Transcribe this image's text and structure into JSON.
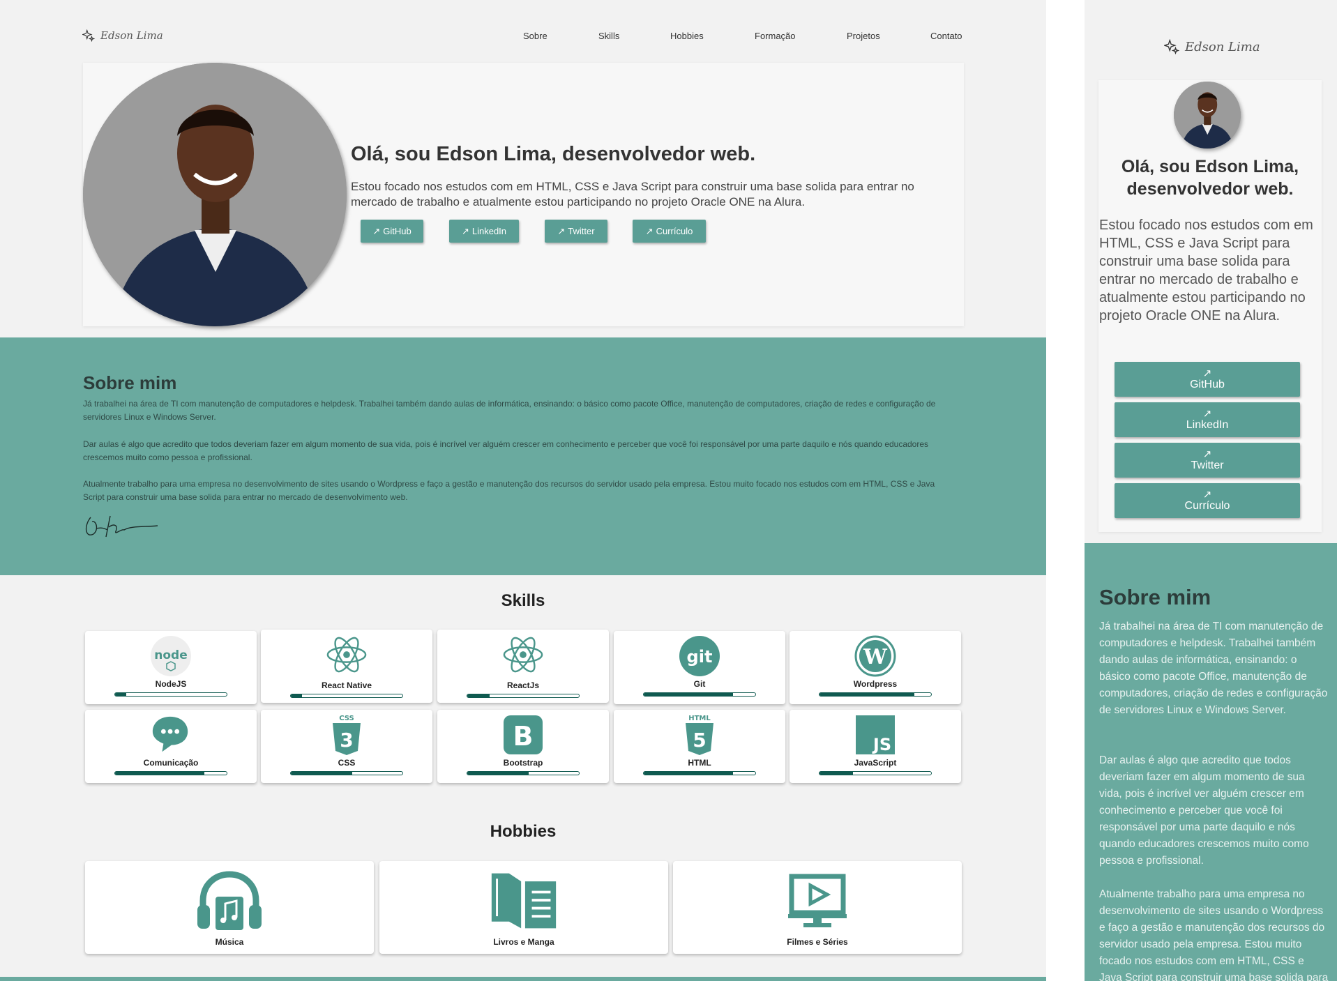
{
  "brand": {
    "name": "Edson Lima"
  },
  "nav": [
    "Sobre",
    "Skills",
    "Hobbies",
    "Formação",
    "Projetos",
    "Contato"
  ],
  "hero": {
    "title": "Olá, sou Edson Lima, desenvolvedor web.",
    "mobile_title": "Olá, sou Edson Lima, desenvolvedor web.",
    "text": "Estou focado nos estudos com em HTML, CSS e Java Script para construir uma base solida para entrar no mercado de trabalho e atualmente estou participando no projeto Oracle ONE na Alura.",
    "buttons": [
      {
        "label": "GitHub"
      },
      {
        "label": "LinkedIn"
      },
      {
        "label": "Twitter"
      },
      {
        "label": "Currículo"
      }
    ]
  },
  "about": {
    "title": "Sobre mim",
    "paragraphs": [
      "Já trabalhei na área de TI com manutenção de computadores e helpdesk. Trabalhei também dando aulas de informática, ensinando: o básico como pacote Office, manutenção de computadores, criação de redes e configuração de servidores Linux e Windows Server.",
      "Dar aulas é algo que acredito que todos deveriam fazer em algum momento de sua vida, pois é incrível ver alguém crescer em conhecimento e perceber que você foi responsável por uma parte daquilo e nós quando educadores crescemos muito como pessoa e profissional.",
      "Atualmente trabalho para uma empresa no desenvolvimento de sites usando o Wordpress e faço a gestão e manutenção dos recursos do servidor usado pela empresa. Estou muito focado nos estudos com em HTML, CSS e Java Script para construir uma base solida para entrar no mercado de desenvolvimento web."
    ]
  },
  "skills": {
    "title": "Skills",
    "items": [
      {
        "label": "NodeJS",
        "icon": "nodejs-icon",
        "level": 0.1
      },
      {
        "label": "React Native",
        "icon": "react-icon",
        "level": 0.1
      },
      {
        "label": "ReactJs",
        "icon": "react-icon",
        "level": 0.2
      },
      {
        "label": "Git",
        "icon": "git-icon",
        "level": 0.8
      },
      {
        "label": "Wordpress",
        "icon": "wordpress-icon",
        "level": 0.85
      },
      {
        "label": "Comunicação",
        "icon": "chat-icon",
        "level": 0.8
      },
      {
        "label": "CSS",
        "icon": "css3-icon",
        "level": 0.55
      },
      {
        "label": "Bootstrap",
        "icon": "bootstrap-icon",
        "level": 0.55
      },
      {
        "label": "HTML",
        "icon": "html5-icon",
        "level": 0.8
      },
      {
        "label": "JavaScript",
        "icon": "javascript-icon",
        "level": 0.3
      }
    ]
  },
  "hobbies": {
    "title": "Hobbies",
    "items": [
      {
        "label": "Música",
        "icon": "headphones-music-icon"
      },
      {
        "label": "Livros e Manga",
        "icon": "book-icon"
      },
      {
        "label": "Filmes e Séries",
        "icon": "monitor-play-icon"
      }
    ]
  },
  "colors": {
    "accent": "#6aaa9f",
    "button": "#5a9e95",
    "dark": "#0f5a50",
    "icon": "#4a968b"
  }
}
